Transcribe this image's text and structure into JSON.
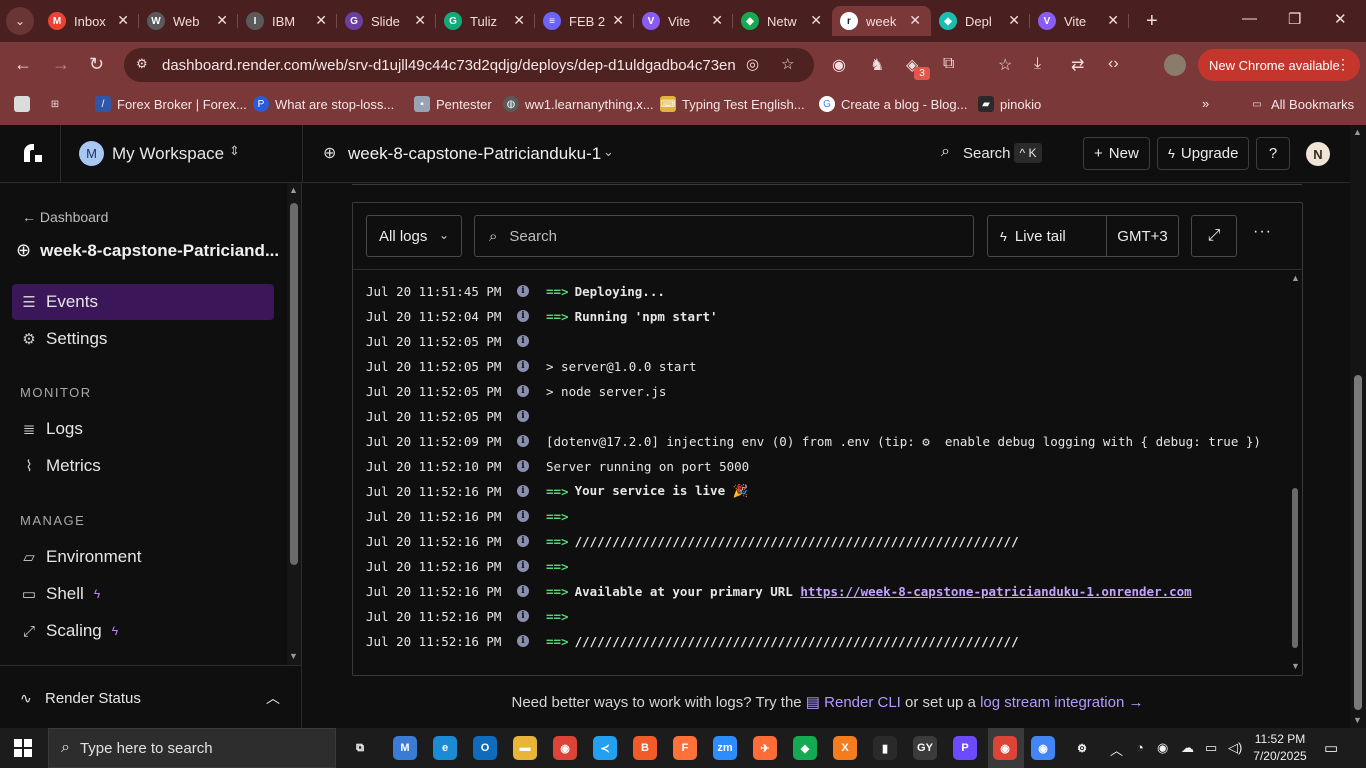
{
  "browser": {
    "tabs": [
      {
        "label": "Inbox",
        "icon": "gmail-icon",
        "color": "#ea4335",
        "glyph": "M"
      },
      {
        "label": "Web",
        "icon": "web-icon",
        "color": "#5a5a5a",
        "glyph": "W"
      },
      {
        "label": "IBM",
        "icon": "ibm-icon",
        "color": "#5a5a5a",
        "glyph": "I"
      },
      {
        "label": "Slide",
        "icon": "slides-icon",
        "color": "#6b3fa0",
        "glyph": "G"
      },
      {
        "label": "Tuliz",
        "icon": "grammarly-icon",
        "color": "#14a87a",
        "glyph": "G"
      },
      {
        "label": "FEB 2",
        "icon": "list-icon",
        "color": "#6c63ff",
        "glyph": "≡"
      },
      {
        "label": "Vite",
        "icon": "vite-icon",
        "color": "#8a5cf6",
        "glyph": "V"
      },
      {
        "label": "Netw",
        "icon": "mongodb-icon",
        "color": "#13aa52",
        "glyph": "◆"
      },
      {
        "label": "week",
        "icon": "render-icon",
        "color": "#ffffff",
        "glyph": "r"
      },
      {
        "label": "Depl",
        "icon": "deploy-icon",
        "color": "#16c0b0",
        "glyph": "◆"
      },
      {
        "label": "Vite",
        "icon": "vite-icon",
        "color": "#8a5cf6",
        "glyph": "V"
      }
    ],
    "active_tab_index": 8,
    "url": "dashboard.render.com/web/srv-d1ujll49c44c73d2qdjg/deploys/dep-d1uldgadbo4c73en...",
    "update_label": "New Chrome available",
    "extension_badge": "3",
    "bookmarks": [
      {
        "label": "",
        "icon": "square-icon"
      },
      {
        "label": "",
        "icon": "apps-icon"
      },
      {
        "label": "Forex Broker | Forex...",
        "icon": "forex-icon"
      },
      {
        "label": "What are stop-loss...",
        "icon": "stoploss-icon"
      },
      {
        "label": "Pentester",
        "icon": "pentester-icon"
      },
      {
        "label": "ww1.learnanything.x...",
        "icon": "globe-icon"
      },
      {
        "label": "Typing Test English...",
        "icon": "typing-icon"
      },
      {
        "label": "Create a blog - Blog...",
        "icon": "google-icon"
      },
      {
        "label": "pinokio",
        "icon": "pinokio-icon"
      }
    ],
    "all_bookmarks_label": "All Bookmarks"
  },
  "app": {
    "workspace": {
      "initial": "M",
      "name": "My Workspace"
    },
    "service_name": "week-8-capstone-Patricianduku-1",
    "search_label": "Search",
    "search_shortcut": "^ K",
    "new_label": "New",
    "upgrade_label": "Upgrade",
    "user_initial": "N"
  },
  "sidebar": {
    "back_label": "Dashboard",
    "service_label": "week-8-capstone-Patriciand...",
    "items": [
      {
        "label": "Events",
        "icon": "events-icon",
        "active": true
      },
      {
        "label": "Settings",
        "icon": "settings-icon"
      }
    ],
    "monitor_heading": "MONITOR",
    "monitor_items": [
      {
        "label": "Logs",
        "icon": "logs-icon"
      },
      {
        "label": "Metrics",
        "icon": "metrics-icon"
      }
    ],
    "manage_heading": "MANAGE",
    "manage_items": [
      {
        "label": "Environment",
        "icon": "environment-icon"
      },
      {
        "label": "Shell",
        "icon": "shell-icon",
        "upgrade": true
      },
      {
        "label": "Scaling",
        "icon": "scaling-icon",
        "upgrade": true
      }
    ],
    "render_status_label": "Render Status"
  },
  "logs": {
    "filter_label": "All logs",
    "search_placeholder": "Search",
    "live_tail_label": "Live tail",
    "timezone": "GMT+3",
    "lines": [
      {
        "time": "Jul 20 11:51:45 PM",
        "arrow": "==>",
        "text": "Deploying...",
        "bold": true
      },
      {
        "time": "Jul 20 11:52:04 PM",
        "arrow": "==>",
        "text": "Running 'npm start'",
        "bold": true
      },
      {
        "time": "Jul 20 11:52:05 PM",
        "arrow": "",
        "text": ""
      },
      {
        "time": "Jul 20 11:52:05 PM",
        "arrow": "",
        "text": "> server@1.0.0 start"
      },
      {
        "time": "Jul 20 11:52:05 PM",
        "arrow": "",
        "text": "> node server.js"
      },
      {
        "time": "Jul 20 11:52:05 PM",
        "arrow": "",
        "text": ""
      },
      {
        "time": "Jul 20 11:52:09 PM",
        "arrow": "",
        "text": "[dotenv@17.2.0] injecting env (0) from .env (tip: ⚙  enable debug logging with { debug: true })"
      },
      {
        "time": "Jul 20 11:52:10 PM",
        "arrow": "",
        "text": "Server running on port 5000"
      },
      {
        "time": "Jul 20 11:52:16 PM",
        "arrow": "==>",
        "text": "Your service is live 🎉",
        "bold": true
      },
      {
        "time": "Jul 20 11:52:16 PM",
        "arrow": "==>",
        "text": ""
      },
      {
        "time": "Jul 20 11:52:16 PM",
        "arrow": "==>",
        "text": "///////////////////////////////////////////////////////////",
        "bold": true
      },
      {
        "time": "Jul 20 11:52:16 PM",
        "arrow": "==>",
        "text": ""
      },
      {
        "time": "Jul 20 11:52:16 PM",
        "arrow": "==>",
        "text": "Available at your primary URL ",
        "bold": true,
        "url": "https://week-8-capstone-patricianduku-1.onrender.com"
      },
      {
        "time": "Jul 20 11:52:16 PM",
        "arrow": "==>",
        "text": ""
      },
      {
        "time": "Jul 20 11:52:16 PM",
        "arrow": "==>",
        "text": "///////////////////////////////////////////////////////////",
        "bold": true
      }
    ],
    "footer_prefix": "Need better ways to work with logs? Try the ",
    "footer_cli": "Render CLI",
    "footer_middle": " or set up a ",
    "footer_stream": "log stream integration →"
  },
  "taskbar": {
    "search_placeholder": "Type here to search",
    "time": "11:52 PM",
    "date": "7/20/2025",
    "apps": [
      {
        "icon": "task-view-icon",
        "color": "#1c1c1c",
        "glyph": "⧉"
      },
      {
        "icon": "m365-icon",
        "color": "#3a7bd5",
        "glyph": "M"
      },
      {
        "icon": "edge-icon",
        "color": "#1b8bd6",
        "glyph": "e"
      },
      {
        "icon": "outlook-icon",
        "color": "#0f6cbd",
        "glyph": "O"
      },
      {
        "icon": "file-explorer-icon",
        "color": "#e8b43a",
        "glyph": "▬"
      },
      {
        "icon": "chrome-icon",
        "color": "#db4437",
        "glyph": "◉"
      },
      {
        "icon": "vscode-icon",
        "color": "#23a0f0",
        "glyph": "≺"
      },
      {
        "icon": "brave-icon",
        "color": "#f15a29",
        "glyph": "B"
      },
      {
        "icon": "firefox-icon",
        "color": "#ff7139",
        "glyph": "F"
      },
      {
        "icon": "zoom-icon",
        "color": "#2d8cff",
        "glyph": "zm"
      },
      {
        "icon": "postman-icon",
        "color": "#ff6c37",
        "glyph": "✈"
      },
      {
        "icon": "mongodb-compass-icon",
        "color": "#13aa52",
        "glyph": "◆"
      },
      {
        "icon": "xampp-icon",
        "color": "#f57c1e",
        "glyph": "X"
      },
      {
        "icon": "terminal-icon",
        "color": "#2a2a2a",
        "glyph": "▮"
      },
      {
        "icon": "gy-icon",
        "color": "#3b3b3b",
        "glyph": "GY"
      },
      {
        "icon": "proton-icon",
        "color": "#6d4aff",
        "glyph": "P"
      },
      {
        "icon": "chrome-active-icon",
        "color": "#db4437",
        "glyph": "◉"
      },
      {
        "icon": "chrome-profile-icon",
        "color": "#4285f4",
        "glyph": "◉"
      },
      {
        "icon": "settings-gear-icon",
        "color": "#1c1c1c",
        "glyph": "⚙"
      }
    ]
  }
}
